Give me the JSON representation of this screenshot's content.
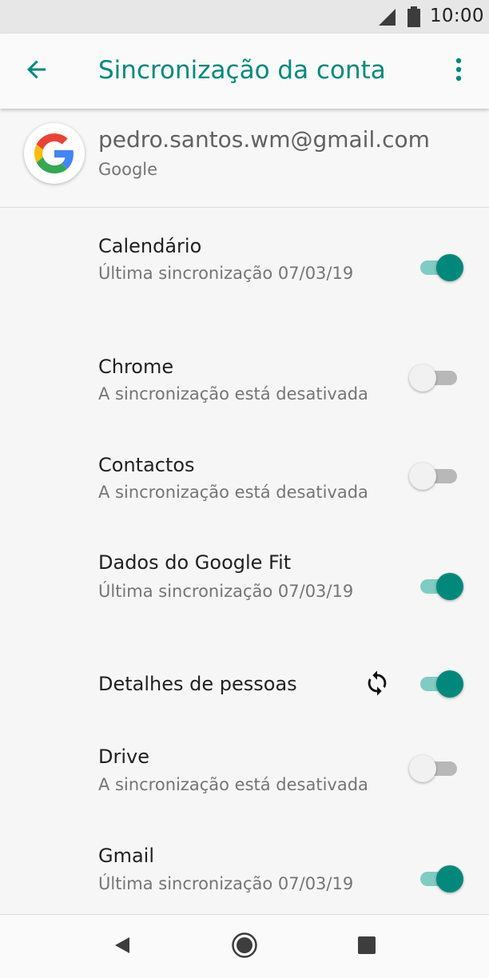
{
  "status_bar": {
    "time": "10:00"
  },
  "app_bar": {
    "title": "Sincronização da conta"
  },
  "account": {
    "email": "pedro.santos.wm@gmail.com",
    "provider": "Google"
  },
  "items": [
    {
      "label": "Calendário",
      "subtitle": "Última sincronização 07/03/19",
      "enabled": true
    },
    {
      "label": "Chrome",
      "subtitle": "A sincronização está desativada",
      "enabled": false
    },
    {
      "label": "Contactos",
      "subtitle": "A sincronização está desativada",
      "enabled": false
    },
    {
      "label": "Dados do Google Fit",
      "subtitle": "Última sincronização 07/03/19",
      "enabled": true
    },
    {
      "label": "Detalhes de pessoas",
      "subtitle": "",
      "enabled": true,
      "syncing": true
    },
    {
      "label": "Drive",
      "subtitle": "A sincronização está desativada",
      "enabled": false
    },
    {
      "label": "Gmail",
      "subtitle": "Última sincronização 07/03/19",
      "enabled": true
    }
  ],
  "icons": {
    "back": "arrow-back-icon",
    "menu": "more-vert-icon",
    "sync": "sync-icon",
    "nav_back": "triangle-back-icon",
    "nav_home": "circle-home-icon",
    "nav_recents": "square-recents-icon"
  },
  "colors": {
    "accent": "#00897b",
    "accent_track": "#80cbc4",
    "off_thumb": "#f1f1f1",
    "off_track": "#b8b8b8"
  }
}
